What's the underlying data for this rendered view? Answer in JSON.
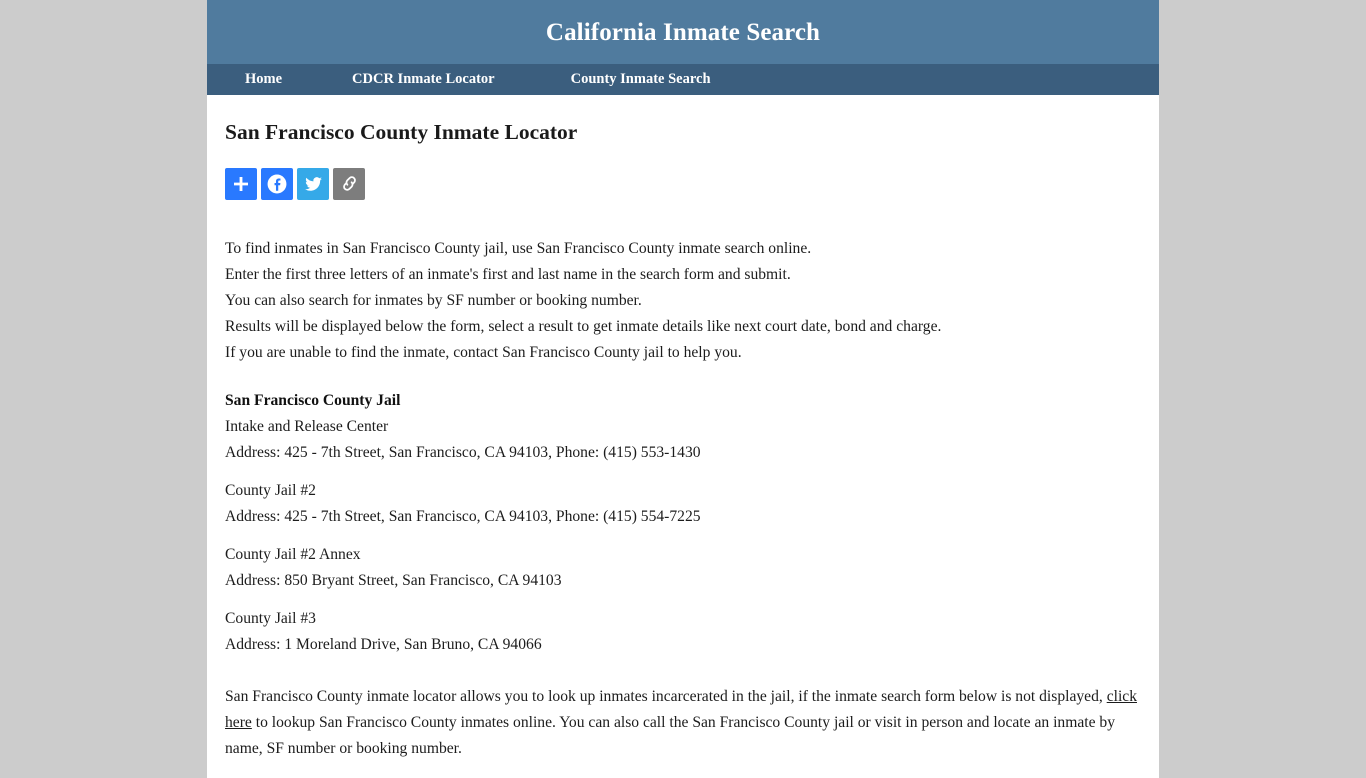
{
  "site": {
    "masthead_title": "California Inmate Search",
    "header_color": "#507b9e",
    "nav_color": "#3b5e7e",
    "page_background": "#cccccc",
    "content_background": "#ffffff"
  },
  "nav": {
    "items": [
      {
        "label": "Home",
        "name": "nav-item-home"
      },
      {
        "label": "CDCR Inmate Locator",
        "name": "nav-item-cdcr-inmate-locator"
      },
      {
        "label": "County Inmate Search",
        "name": "nav-item-county-inmate-search"
      }
    ]
  },
  "main": {
    "heading": "San Francisco County Inmate Locator",
    "share": {
      "buttons": [
        {
          "icon": "share-plus-icon",
          "label": "Share",
          "color": "#2979ff"
        },
        {
          "icon": "facebook-icon",
          "label": "Facebook",
          "color": "#2979ff"
        },
        {
          "icon": "twitter-icon",
          "label": "Twitter",
          "color": "#35a9e8"
        },
        {
          "icon": "copy-link-icon",
          "label": "Copy Link",
          "color": "#7d7d7d"
        }
      ]
    },
    "intro_lines": [
      "To find inmates in San Francisco County jail, use San Francisco County inmate search online.",
      "Enter the first three letters of an inmate's first and last name in the search form and submit.",
      "You can also search for inmates by SF number or booking number.",
      "Results will be displayed below the form, select a result to get inmate details like next court date, bond and charge.",
      "If you are unable to find the inmate, contact San Francisco County jail to help you."
    ],
    "jail_section_title": "San Francisco County Jail",
    "jail_groups": [
      {
        "name": "Intake and Release Center",
        "address": "Address: 425 - 7th Street, San Francisco, CA 94103, Phone: (415) 553-1430"
      },
      {
        "name": "County Jail #2",
        "address": "Address: 425 - 7th Street, San Francisco, CA 94103, Phone: (415) 554-7225"
      },
      {
        "name": "County Jail #2 Annex",
        "address": "Address: 850 Bryant Street, San Francisco, CA 94103"
      },
      {
        "name": "County Jail #3",
        "address": "Address: 1 Moreland Drive, San Bruno, CA 94066"
      }
    ],
    "closing": {
      "part1": "San Francisco County inmate locator allows you to look up inmates incarcerated in the jail, if the inmate search form below is not displayed, ",
      "link_text": "click here",
      "part2": " to lookup San Francisco County inmates online. You can also call the San Francisco County jail or visit in person and locate an inmate by name, SF number or booking number."
    }
  }
}
